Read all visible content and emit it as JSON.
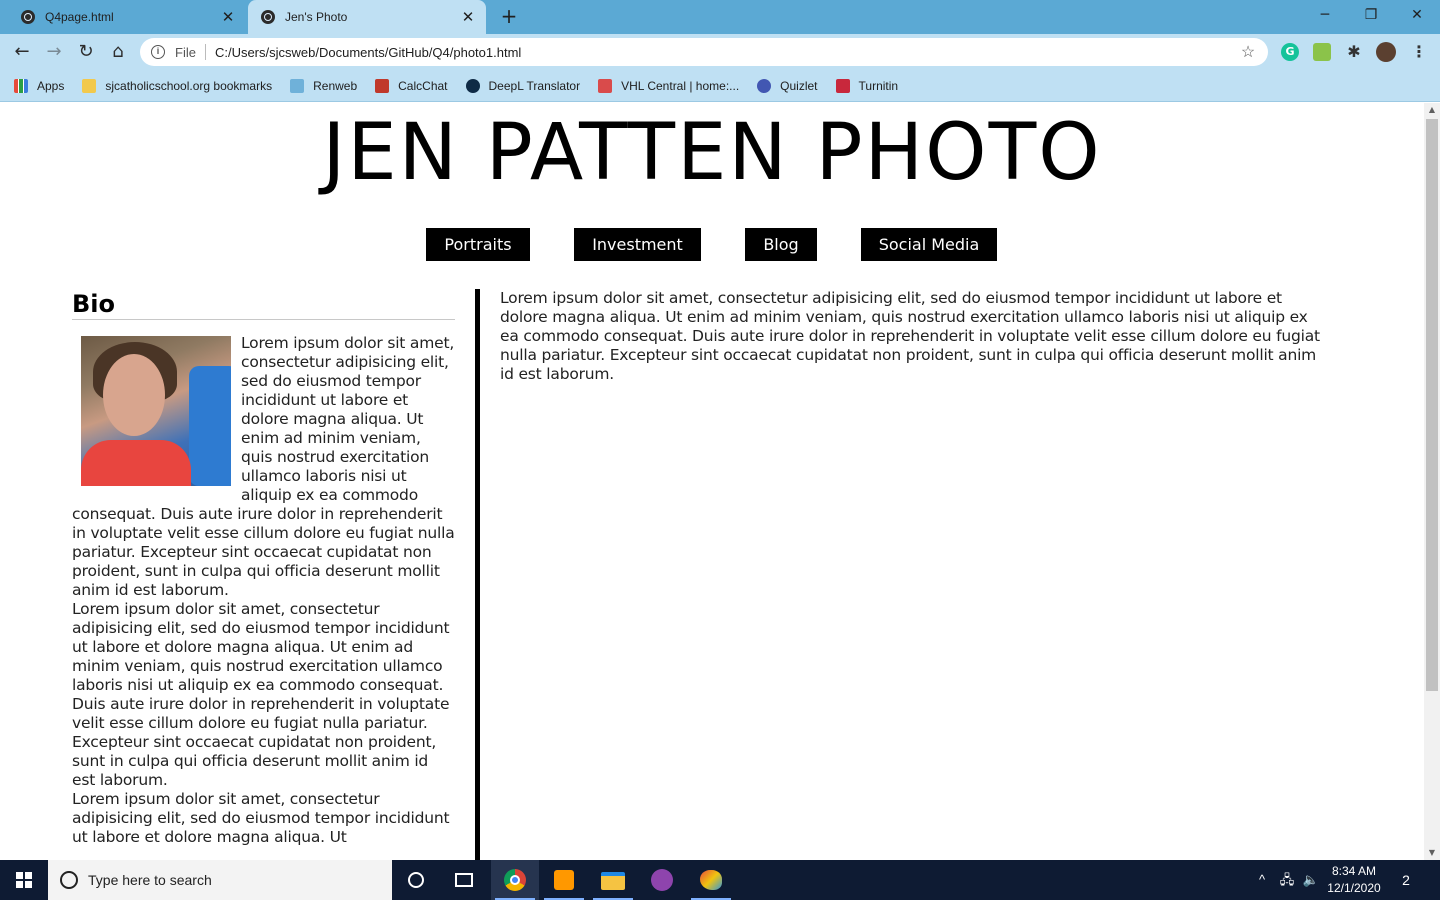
{
  "browser": {
    "tabs": [
      {
        "title": "Q4page.html",
        "close": "✕"
      },
      {
        "title": "Jen's Photo",
        "close": "✕"
      }
    ],
    "new_tab": "+",
    "window_controls": {
      "minimize": "─",
      "restore": "❐",
      "close": "✕"
    },
    "nav": {
      "back": "←",
      "forward": "→",
      "reload": "↻",
      "home": "⌂"
    },
    "omnibox": {
      "info": "i",
      "scheme": "File",
      "url": "C:/Users/sjcsweb/Documents/GitHub/Q4/photo1.html",
      "star": "☆"
    },
    "extensions": {
      "grammarly": "G",
      "puzzle": "✱",
      "menu": "⋮"
    },
    "bookmarks": [
      {
        "label": "Apps",
        "color": "#e64a3b"
      },
      {
        "label": "sjcatholicschool.org bookmarks",
        "color": "#f2c94c"
      },
      {
        "label": "Renweb",
        "color": "#6fb1d9"
      },
      {
        "label": "CalcChat",
        "color": "#c0392b"
      },
      {
        "label": "DeepL Translator",
        "color": "#0f2b46"
      },
      {
        "label": "VHL Central | home:...",
        "color": "#d94b4b"
      },
      {
        "label": "Quizlet",
        "color": "#4257b2"
      },
      {
        "label": "Turnitin",
        "color": "#c8283c"
      }
    ]
  },
  "site": {
    "title": "JEN PATTEN PHOTO",
    "nav": [
      "Portraits",
      "Investment",
      "Blog",
      "Social Media"
    ],
    "bio": {
      "heading": "Bio",
      "paragraphs": [
        "Lorem ipsum dolor sit amet, consectetur adipisicing elit, sed do eiusmod tempor incididunt ut labore et dolore magna aliqua. Ut enim ad minim veniam, quis nostrud exercitation ullamco laboris nisi ut aliquip ex ea commodo consequat. Duis aute irure dolor in reprehenderit in voluptate velit esse cillum dolore eu fugiat nulla pariatur. Excepteur sint occaecat cupidatat non proident, sunt in culpa qui officia deserunt mollit anim id est laborum.",
        "Lorem ipsum dolor sit amet, consectetur adipisicing elit, sed do eiusmod tempor incididunt ut labore et dolore magna aliqua. Ut enim ad minim veniam, quis nostrud exercitation ullamco laboris nisi ut aliquip ex ea commodo consequat. Duis aute irure dolor in reprehenderit in voluptate velit esse cillum dolore eu fugiat nulla pariatur. Excepteur sint occaecat cupidatat non proident, sunt in culpa qui officia deserunt mollit anim id est laborum.",
        "Lorem ipsum dolor sit amet, consectetur adipisicing elit, sed do eiusmod tempor incididunt ut labore et dolore magna aliqua. Ut"
      ]
    },
    "main_text": "Lorem ipsum dolor sit amet, consectetur adipisicing elit, sed do eiusmod tempor incididunt ut labore et dolore magna aliqua. Ut enim ad minim veniam, quis nostrud exercitation ullamco laboris nisi ut aliquip ex ea commodo consequat. Duis aute irure dolor in reprehenderit in voluptate velit esse cillum dolore eu fugiat nulla pariatur. Excepteur sint occaecat cupidatat non proident, sunt in culpa qui officia deserunt mollit anim id est laborum."
  },
  "scrollbar": {
    "up": "▲",
    "down": "▼"
  },
  "taskbar": {
    "search_placeholder": "Type here to search",
    "apps": [
      "cortana-icon",
      "task-view-icon",
      "chrome-icon",
      "sublime-text-icon",
      "file-explorer-icon",
      "github-desktop-icon",
      "paint-icon"
    ],
    "tray": {
      "chevron": "^",
      "network": "🖧",
      "volume": "🔈"
    },
    "time": "8:34 AM",
    "date": "12/1/2020",
    "notifications": "2"
  }
}
